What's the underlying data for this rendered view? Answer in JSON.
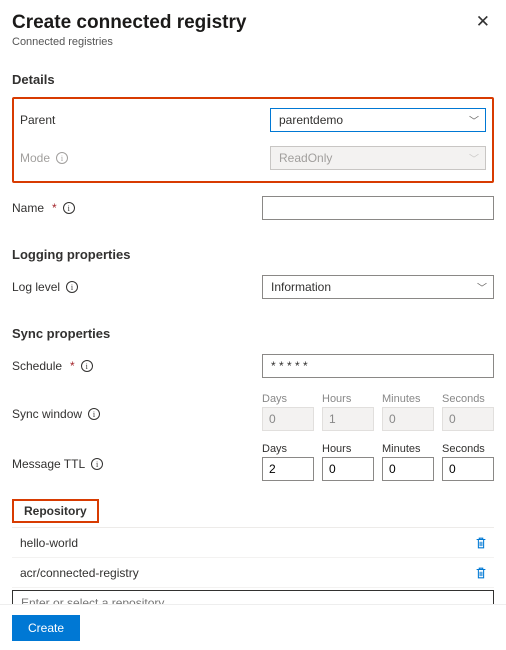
{
  "header": {
    "title": "Create connected registry",
    "subtitle": "Connected registries"
  },
  "sections": {
    "details": "Details",
    "logging": "Logging properties",
    "sync": "Sync properties",
    "repository_tab": "Repository"
  },
  "labels": {
    "parent": "Parent",
    "mode": "Mode",
    "name": "Name",
    "log_level": "Log level",
    "schedule": "Schedule",
    "sync_window": "Sync window",
    "message_ttl": "Message TTL",
    "days": "Days",
    "hours": "Hours",
    "minutes": "Minutes",
    "seconds": "Seconds"
  },
  "values": {
    "parent": "parentdemo",
    "mode": "ReadOnly",
    "name": "",
    "log_level": "Information",
    "schedule": "* * * * *",
    "sync_window": {
      "days": "0",
      "hours": "1",
      "minutes": "0",
      "seconds": "0"
    },
    "message_ttl": {
      "days": "2",
      "hours": "0",
      "minutes": "0",
      "seconds": "0"
    }
  },
  "repositories": [
    {
      "name": "hello-world"
    },
    {
      "name": "acr/connected-registry"
    }
  ],
  "repo_placeholder": "Enter or select a repository",
  "footer": {
    "create": "Create"
  }
}
